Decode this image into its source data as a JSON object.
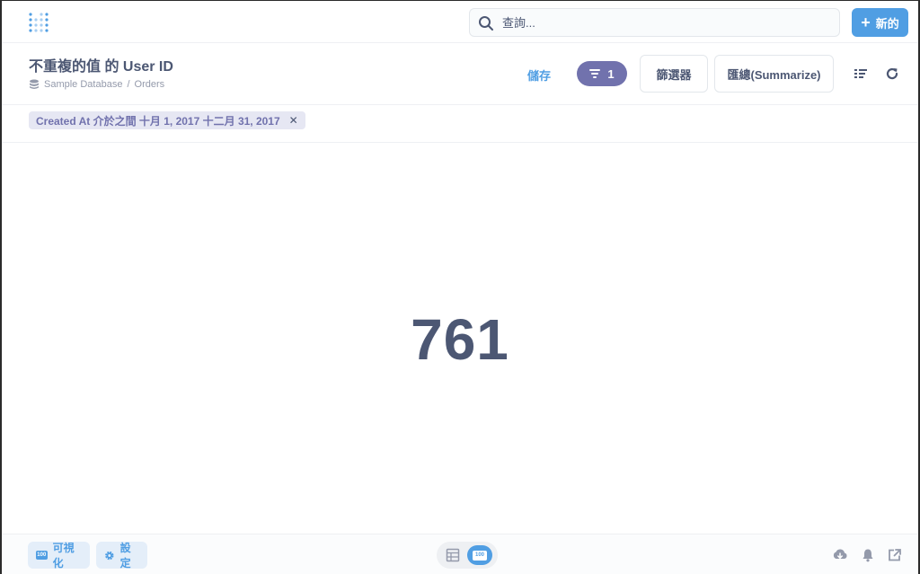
{
  "nav": {
    "search_placeholder": "查詢...",
    "new_button_label": "新的"
  },
  "question": {
    "title": "不重複的值 的 User ID",
    "breadcrumb": {
      "database": "Sample Database",
      "separator": "/",
      "table": "Orders"
    },
    "save_label": "儲存",
    "filter_count": "1",
    "filter_button_label": "篩選器",
    "summarize_button_label": "匯總(Summarize)"
  },
  "filters": [
    {
      "label": "Created At 介於之間 十月 1, 2017 十二月 31, 2017"
    }
  ],
  "result": {
    "value": "761"
  },
  "footer": {
    "visualize_label": "可視化",
    "settings_label": "設定",
    "number_badge": "100"
  },
  "colors": {
    "brand": "#509ee3",
    "filter": "#7172ad",
    "text": "#4c5773"
  }
}
